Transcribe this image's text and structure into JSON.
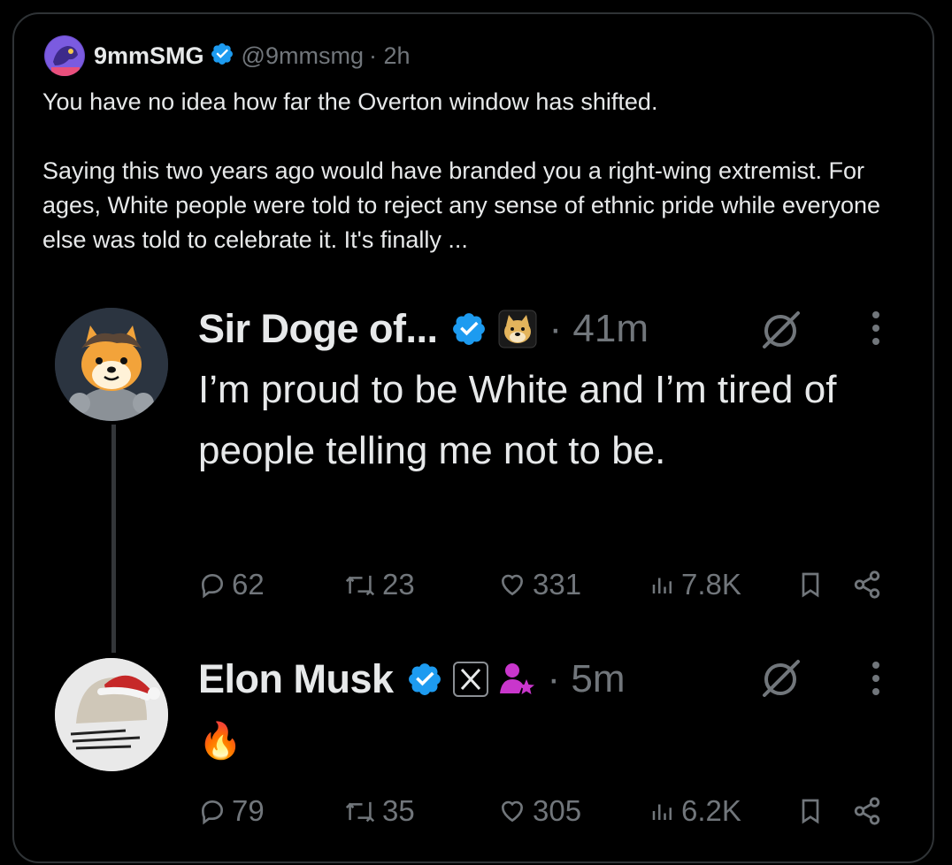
{
  "main_post": {
    "author_name": "9mmSMG",
    "author_handle": "@9mmsmg",
    "time": "· 2h",
    "text_line1": "You have no idea how far the  Overton window has shifted.",
    "text_para2": "Saying this two years ago would have branded you a right-wing extremist. For ages, White people were told to reject any sense of ethnic pride while everyone else was told to celebrate it. It's finally ..."
  },
  "quoted_thread": [
    {
      "author_name": "Sir Doge of...",
      "time": "· 41m",
      "text": "I’m proud to be White and I’m tired of people telling me not to be.",
      "replies": "62",
      "reposts": "23",
      "likes": "331",
      "views": "7.8K"
    },
    {
      "author_name": "Elon Musk",
      "time": "· 5m",
      "text": "🔥",
      "replies": "79",
      "reposts": "35",
      "likes": "305",
      "views": "6.2K"
    }
  ],
  "colors": {
    "background": "#000000",
    "border": "#2f3336",
    "text": "#e7e9ea",
    "muted": "#71767b",
    "verified_blue": "#1d9bf0",
    "affiliate_purple": "#c936cc"
  },
  "icons": [
    "verified-badge-icon",
    "reply-icon",
    "repost-icon",
    "like-icon",
    "views-icon",
    "bookmark-icon",
    "share-icon",
    "grok-icon",
    "more-icon",
    "x-logo-icon",
    "affiliate-icon",
    "doge-icon"
  ]
}
